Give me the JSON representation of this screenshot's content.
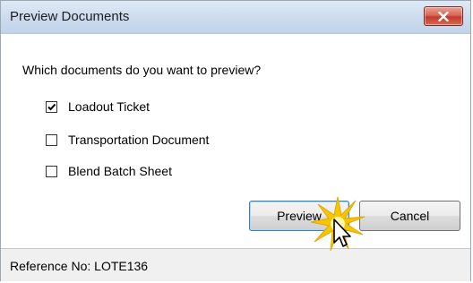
{
  "window": {
    "title": "Preview Documents",
    "close_icon": "close-x-icon"
  },
  "dialog": {
    "prompt": "Which documents do you want to preview?",
    "options": [
      {
        "label": "Loadout Ticket",
        "checked": true
      },
      {
        "label": "Transportation Document",
        "checked": false
      },
      {
        "label": "Blend Batch Sheet",
        "checked": false
      }
    ],
    "buttons": {
      "preview_label": "Preview",
      "cancel_label": "Cancel"
    }
  },
  "statusbar": {
    "reference_text": "Reference No: LOTE136"
  },
  "colors": {
    "titlebar": "#cddcee",
    "close_button": "#c4392b",
    "default_button_border": "#3c7fb1",
    "click_burst": "#f7c600"
  }
}
